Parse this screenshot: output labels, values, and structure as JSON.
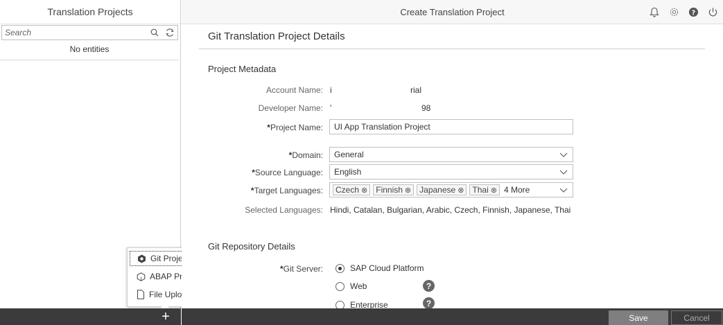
{
  "left_panel": {
    "title": "Translation Projects",
    "search_placeholder": "Search",
    "empty_text": "No entities",
    "menu": [
      {
        "label": "Git Project",
        "icon": "git-icon"
      },
      {
        "label": "ABAP Project",
        "icon": "abap-icon"
      },
      {
        "label": "File Upload",
        "icon": "file-icon"
      }
    ]
  },
  "topbar": {
    "title": "Create Translation Project",
    "icons": [
      "bell-icon",
      "gear-icon",
      "help-icon",
      "power-icon"
    ]
  },
  "form": {
    "title": "Git Translation Project Details",
    "metadata_title": "Project Metadata",
    "account_label": "Account Name:",
    "account_value_start": "i",
    "account_value_end": "rial",
    "developer_label": "Developer Name:",
    "developer_value_start": "'",
    "developer_value_end": "98",
    "project_label": "Project Name:",
    "project_value": "UI App Translation Project",
    "required_mark": "*",
    "domain_label": "Domain:",
    "domain_value": "General",
    "source_label": "Source Language:",
    "source_value": "English",
    "target_label": "Target Languages:",
    "target_tokens": [
      "Czech",
      "Finnish",
      "Japanese",
      "Thai"
    ],
    "target_more": "4 More",
    "selected_label": "Selected Languages:",
    "selected_value": "Hindi, Catalan, Bulgarian, Arabic, Czech, Finnish, Japanese, Thai",
    "git_section_title": "Git Repository Details",
    "git_server_label": "Git Server:",
    "git_options": [
      {
        "label": "SAP Cloud Platform",
        "selected": true
      },
      {
        "label": "Web",
        "selected": false
      },
      {
        "label": "Enterprise",
        "selected": false
      }
    ]
  },
  "footer": {
    "add_label": "+",
    "save_label": "Save",
    "cancel_label": "Cancel"
  },
  "colors": {
    "footer_bg": "#3b3b3b",
    "save_bg": "#7f7f7f"
  }
}
